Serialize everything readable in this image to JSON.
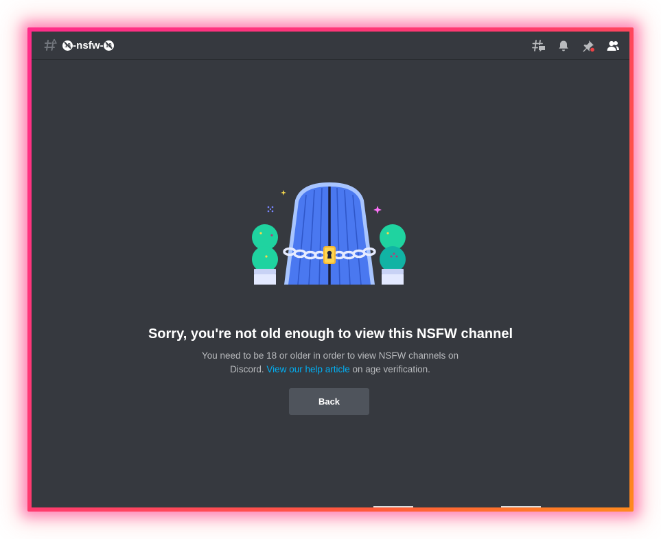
{
  "header": {
    "channel_icon": "hashtag-nsfw-icon",
    "channel_badge_left": "18",
    "channel_name": "-nsfw-",
    "channel_badge_right": "18",
    "toolbar_icons": [
      "threads-icon",
      "bell-icon",
      "pin-icon",
      "members-icon"
    ]
  },
  "gate": {
    "illustration": "locked-door-illustration",
    "title": "Sorry, you're not old enough to view this NSFW channel",
    "desc_before": "You need to be 18 or older in order to view NSFW channels on Discord.",
    "link_text": "View our help article",
    "desc_after": "on age verification.",
    "back_label": "Back"
  },
  "colors": {
    "background": "#36393f",
    "link": "#00b0f4",
    "button": "#4f545c",
    "frame_start": "#ff2d8a",
    "frame_end": "#ff8a1e",
    "pin_dot": "#ed4245"
  }
}
